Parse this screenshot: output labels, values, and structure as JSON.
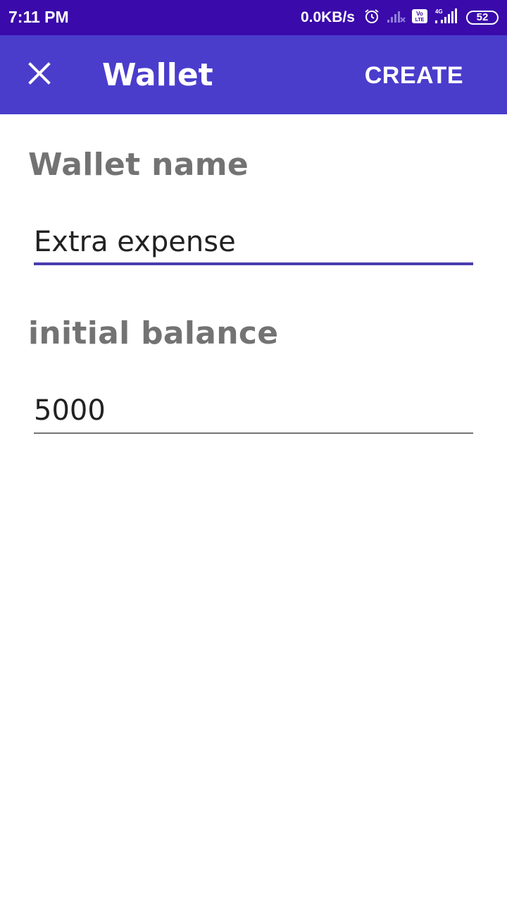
{
  "status_bar": {
    "time": "7:11 PM",
    "net_speed": "0.0KB/s",
    "network_label": "4G",
    "volte_label": "Vo\nLTE",
    "battery": "52",
    "icons": [
      "alarm-icon",
      "signal-no-service-icon",
      "volte-icon",
      "signal-4g-icon",
      "battery-icon"
    ],
    "background_color": "#3a0aaa"
  },
  "app_bar": {
    "title": "Wallet",
    "action_label": "CREATE",
    "close_icon": "close-icon",
    "background_color": "#4a3dcc"
  },
  "form": {
    "wallet_name": {
      "label": "Wallet name",
      "value": "Extra expense",
      "focused": true
    },
    "initial_balance": {
      "label": "initial balance",
      "value": "5000",
      "focused": false
    },
    "accent_color": "#4a3db0"
  }
}
